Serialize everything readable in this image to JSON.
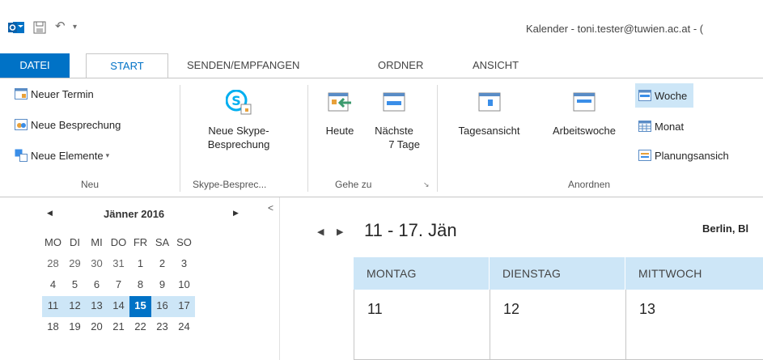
{
  "title_bar": {
    "title": "Kalender - toni.tester@tuwien.ac.at - ("
  },
  "tabs": [
    {
      "label": "DATEI"
    },
    {
      "label": "START"
    },
    {
      "label": "SENDEN/EMPFANGEN"
    },
    {
      "label": "ORDNER"
    },
    {
      "label": "ANSICHT"
    }
  ],
  "ribbon": {
    "neu": {
      "termin": "Neuer Termin",
      "besprechung": "Neue Besprechung",
      "elemente": "Neue Elemente",
      "label": "Neu"
    },
    "skype": {
      "line1": "Neue Skype-",
      "line2": "Besprechung",
      "label": "Skype-Besprec..."
    },
    "gehezu": {
      "heute": "Heute",
      "naechste1": "Nächste",
      "naechste2": "7 Tage",
      "label": "Gehe zu"
    },
    "anordnen": {
      "tagesansicht": "Tagesansicht",
      "arbeitswoche": "Arbeitswoche",
      "woche": "Woche",
      "monat": "Monat",
      "planungsansicht": "Planungsansich",
      "label": "Anordnen"
    }
  },
  "mini_calendar": {
    "month": "Jänner 2016",
    "weekdays": [
      "MO",
      "DI",
      "MI",
      "DO",
      "FR",
      "SA",
      "SO"
    ],
    "weeks": [
      [
        "28",
        "29",
        "30",
        "31",
        "1",
        "2",
        "3"
      ],
      [
        "4",
        "5",
        "6",
        "7",
        "8",
        "9",
        "10"
      ],
      [
        "11",
        "12",
        "13",
        "14",
        "15",
        "16",
        "17"
      ],
      [
        "18",
        "19",
        "20",
        "21",
        "22",
        "23",
        "24"
      ]
    ],
    "today": "15"
  },
  "calendar": {
    "range": "11 - 17. Jän",
    "weather_location": "Berlin, Bl",
    "days": [
      {
        "name": "MONTAG",
        "date": "11"
      },
      {
        "name": "DIENSTAG",
        "date": "12"
      },
      {
        "name": "MITTWOCH",
        "date": "13"
      }
    ]
  },
  "colors": {
    "accent": "#0072c6",
    "selection": "#cde6f7"
  }
}
